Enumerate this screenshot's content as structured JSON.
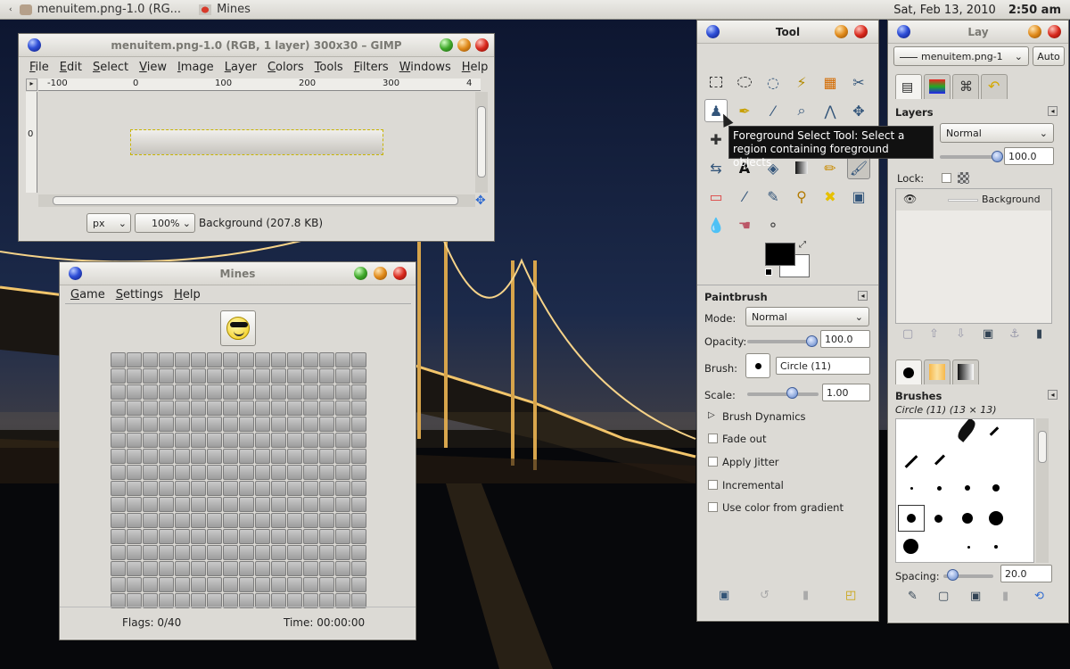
{
  "taskbar": {
    "items": [
      "menuitem.png-1.0 (RG...",
      "Mines"
    ],
    "clock_date": "Sat, Feb 13, 2010",
    "clock_time": "2:50 am"
  },
  "gimp": {
    "title": "menuitem.png-1.0 (RGB, 1 layer) 300x30 – GIMP",
    "menu": [
      "File",
      "Edit",
      "Select",
      "View",
      "Image",
      "Layer",
      "Colors",
      "Tools",
      "Filters",
      "Windows",
      "Help"
    ],
    "ruler": [
      "-100",
      "0",
      "100",
      "200",
      "300",
      "4"
    ],
    "ruler_v": "0",
    "unit": "px",
    "zoom": "100%",
    "status": "Background (207.8 KB)"
  },
  "mines": {
    "title": "Mines",
    "menu": [
      "Game",
      "Settings",
      "Help"
    ],
    "flags": "Flags: 0/40",
    "time": "Time: 00:00:00"
  },
  "toolbox": {
    "title": "Tool",
    "tooltip": "Foreground Select Tool: Select a region containing foreground objects",
    "options_title": "Paintbrush",
    "mode_label": "Mode:",
    "mode": "Normal",
    "opacity_label": "Opacity:",
    "opacity": "100.0",
    "brush_label": "Brush:",
    "brush": "Circle (11)",
    "scale_label": "Scale:",
    "scale": "1.00",
    "dynamics": "Brush Dynamics",
    "checks": [
      "Fade out",
      "Apply Jitter",
      "Incremental",
      "Use color from gradient"
    ],
    "fg_color": "#000000",
    "bg_color": "#ffffff"
  },
  "layers": {
    "title": "Lay",
    "image": "menuitem.png-1",
    "auto": "Auto",
    "panel_title": "Layers",
    "mode": "Normal",
    "opacity": "100.0",
    "lock_label": "Lock:",
    "layer_name": "Background",
    "brushes_title": "Brushes",
    "brush_name": "Circle (11) (13 × 13)",
    "spacing_label": "Spacing:",
    "spacing": "20.0"
  }
}
